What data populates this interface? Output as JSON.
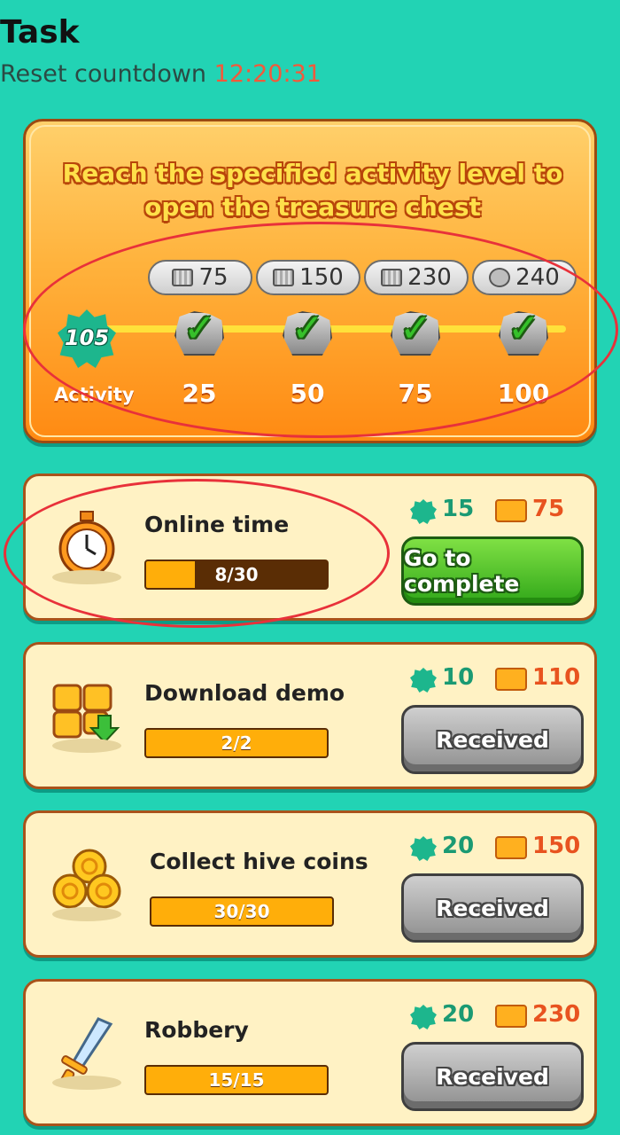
{
  "header": {
    "title": "Task",
    "countdown_label": "Reset countdown",
    "countdown_time": "12:20:31"
  },
  "activity": {
    "instruction": "Reach the specified activity level to open the treasure chest",
    "current_value": "105",
    "label": "Activity",
    "milestones": [
      {
        "threshold": "25",
        "reward": "75",
        "reward_icon": "ticket-icon",
        "claimed": true
      },
      {
        "threshold": "50",
        "reward": "150",
        "reward_icon": "ticket-icon",
        "claimed": true
      },
      {
        "threshold": "75",
        "reward": "230",
        "reward_icon": "ticket-icon",
        "claimed": true
      },
      {
        "threshold": "100",
        "reward": "240",
        "reward_icon": "coin-bag-icon",
        "claimed": true
      }
    ]
  },
  "tasks": [
    {
      "name": "Online time",
      "progress": "8/30",
      "progress_fraction": 0.27,
      "gem_reward": "15",
      "ticket_reward": "75",
      "button": "Go to complete",
      "status": "active",
      "icon": "stopwatch-icon"
    },
    {
      "name": "Download demo",
      "progress": "2/2",
      "progress_fraction": 1,
      "gem_reward": "10",
      "ticket_reward": "110",
      "button": "Received",
      "status": "received",
      "icon": "download-box-icon"
    },
    {
      "name": "Collect hive coins",
      "progress": "30/30",
      "progress_fraction": 1,
      "gem_reward": "20",
      "ticket_reward": "150",
      "button": "Received",
      "status": "received",
      "icon": "coins-icon"
    },
    {
      "name": "Robbery",
      "progress": "15/15",
      "progress_fraction": 1,
      "gem_reward": "20",
      "ticket_reward": "230",
      "button": "Received",
      "status": "received",
      "icon": "sword-icon"
    }
  ],
  "colors": {
    "background": "#22d3b4",
    "accent_orange": "#ff8a12",
    "countdown": "#f25a3b",
    "annotation_red": "#e8313a"
  }
}
